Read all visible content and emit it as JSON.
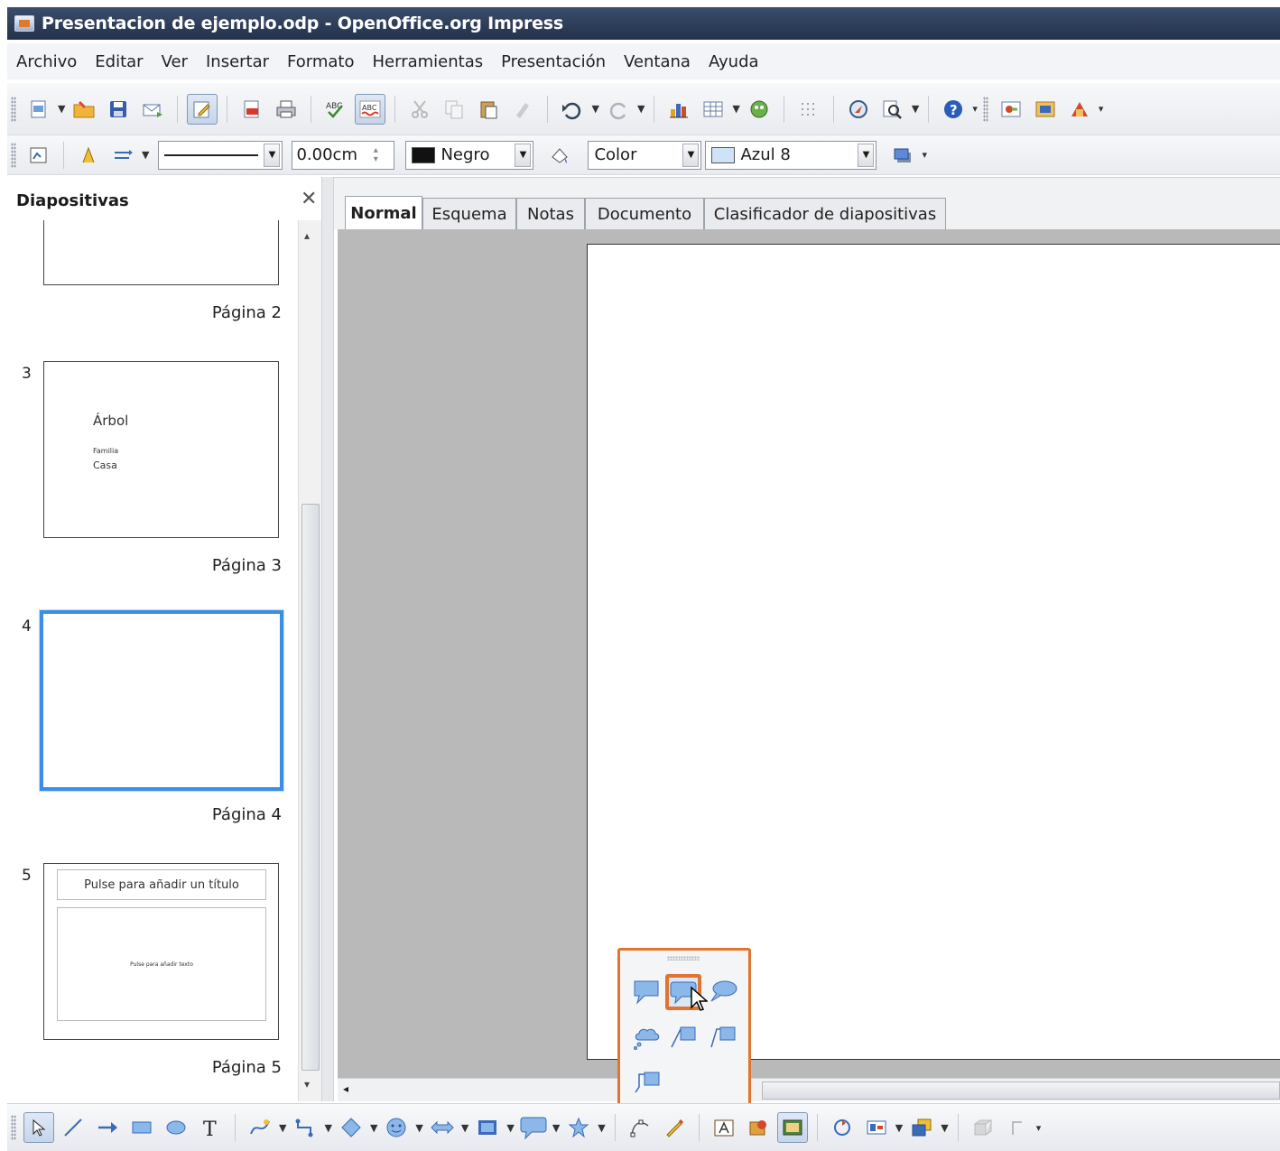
{
  "window": {
    "title": "Presentacion de ejemplo.odp - OpenOffice.org Impress"
  },
  "menu": [
    "Archivo",
    "Editar",
    "Ver",
    "Insertar",
    "Formato",
    "Herramientas",
    "Presentación",
    "Ventana",
    "Ayuda"
  ],
  "line_toolbar": {
    "line_width": "0.00cm",
    "line_color": "Negro",
    "line_color_hex": "#111111",
    "area_style": "Color",
    "area_fill": "Azul 8",
    "area_fill_hex": "#cfe3f7"
  },
  "slide_pane": {
    "title": "Diapositivas",
    "slides": [
      {
        "number": "",
        "label": "Página 2"
      },
      {
        "number": "3",
        "label": "Página 3",
        "content": [
          "Árbol",
          "Familia",
          "Casa"
        ]
      },
      {
        "number": "4",
        "label": "Página 4"
      },
      {
        "number": "5",
        "label": "Página 5",
        "title_placeholder": "Pulse para añadir un título",
        "text_placeholder": "Pulse para añadir texto"
      }
    ]
  },
  "view_tabs": [
    "Normal",
    "Esquema",
    "Notas",
    "Documento",
    "Clasificador de diapositivas"
  ],
  "colors": {
    "highlight": "#e2742f",
    "selection": "#3a8ee6"
  }
}
